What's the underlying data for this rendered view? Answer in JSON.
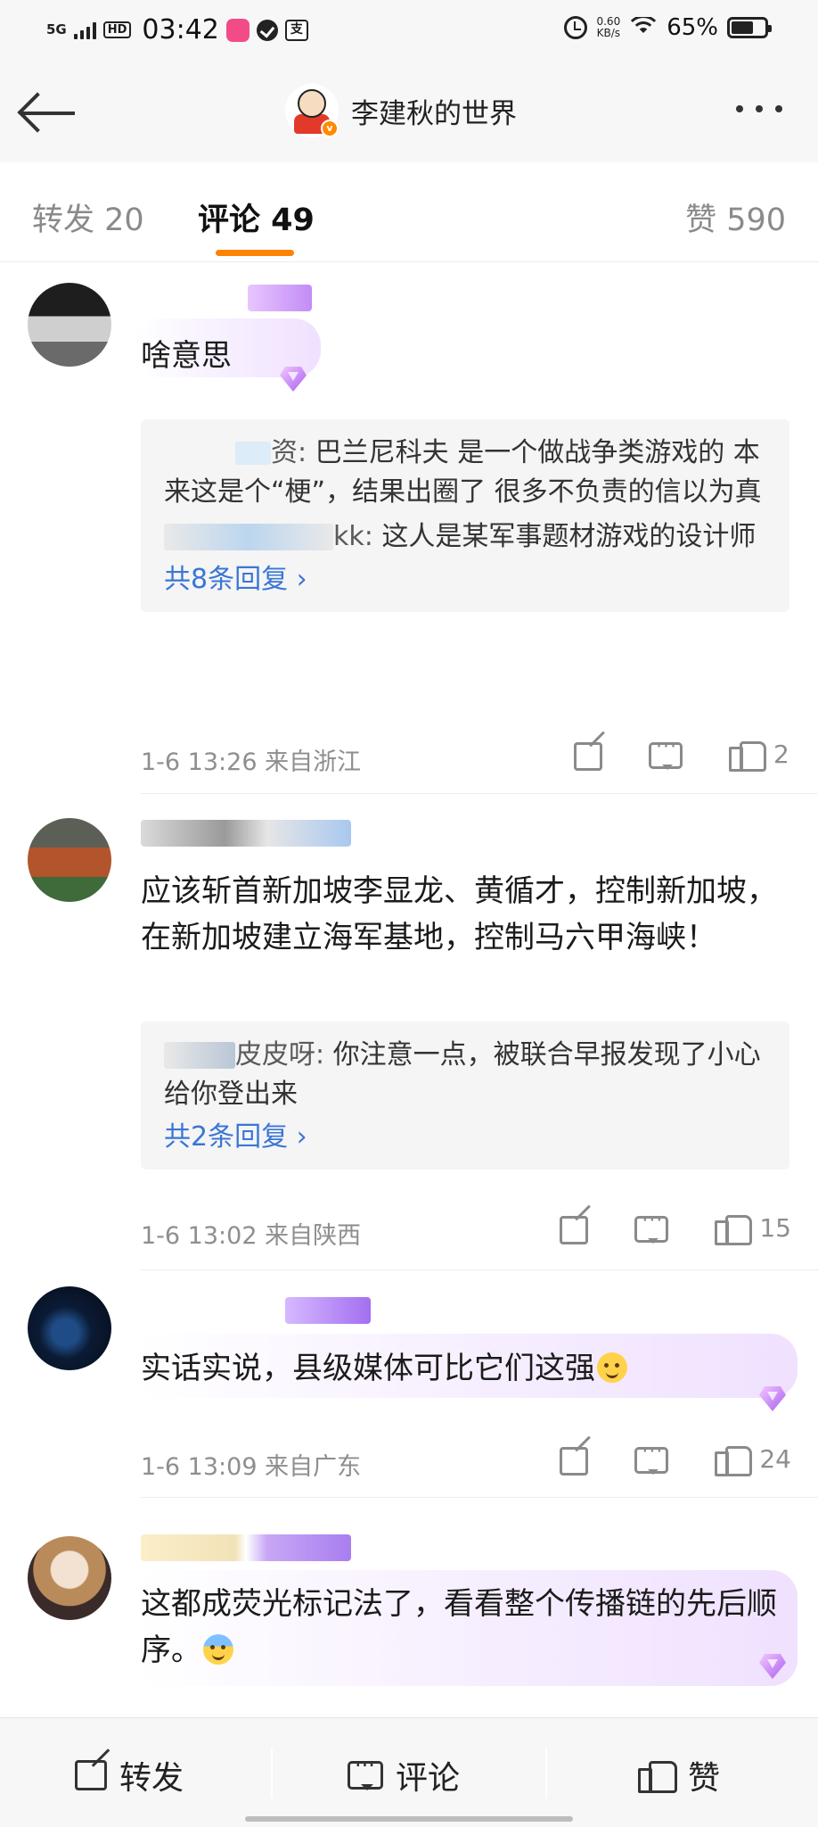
{
  "status_bar": {
    "network": "5G",
    "hd": "HD",
    "time": "03:42",
    "speed_value": "0.60",
    "speed_unit": "KB/s",
    "battery": "65%"
  },
  "header": {
    "title": "李建秋的世界",
    "badge": "v"
  },
  "tabs": [
    {
      "label": "转发 20"
    },
    {
      "label": "评论 49"
    },
    {
      "label": "赞 590"
    }
  ],
  "comments": [
    {
      "text": "啥意思",
      "replies": [
        {
          "user_suffix": "资",
          "text": "巴兰尼科夫 是一个做战争类游戏的 本来这是个“梗”，结果出圈了 很多不负责的信以为真"
        },
        {
          "user_suffix": "kk",
          "text": "这人是某军事题材游戏的设计师"
        }
      ],
      "reply_more": "共8条回复 ›",
      "time": "1-6 13:26",
      "location": "来自浙江",
      "likes": "2"
    },
    {
      "text": "应该斩首新加坡李显龙、黄循才，控制新加坡，在新加坡建立海军基地，控制马六甲海峡！",
      "replies": [
        {
          "user_suffix": "皮皮呀",
          "text": "你注意一点，被联合早报发现了小心给你登出来"
        }
      ],
      "reply_more": "共2条回复 ›",
      "time": "1-6 13:02",
      "location": "来自陕西",
      "likes": "15"
    },
    {
      "text": "实话实说，县级媒体可比它们这强",
      "time": "1-6 13:09",
      "location": "来自广东",
      "likes": "24"
    },
    {
      "text": "这都成荧光标记法了，看看整个传播链的先后顺序。"
    }
  ],
  "bottom_bar": {
    "repost": "转发",
    "comment": "评论",
    "like": "赞"
  },
  "colors": {
    "accent": "#ff8200",
    "link": "#3a76d6",
    "gem": "#a95cf0"
  }
}
